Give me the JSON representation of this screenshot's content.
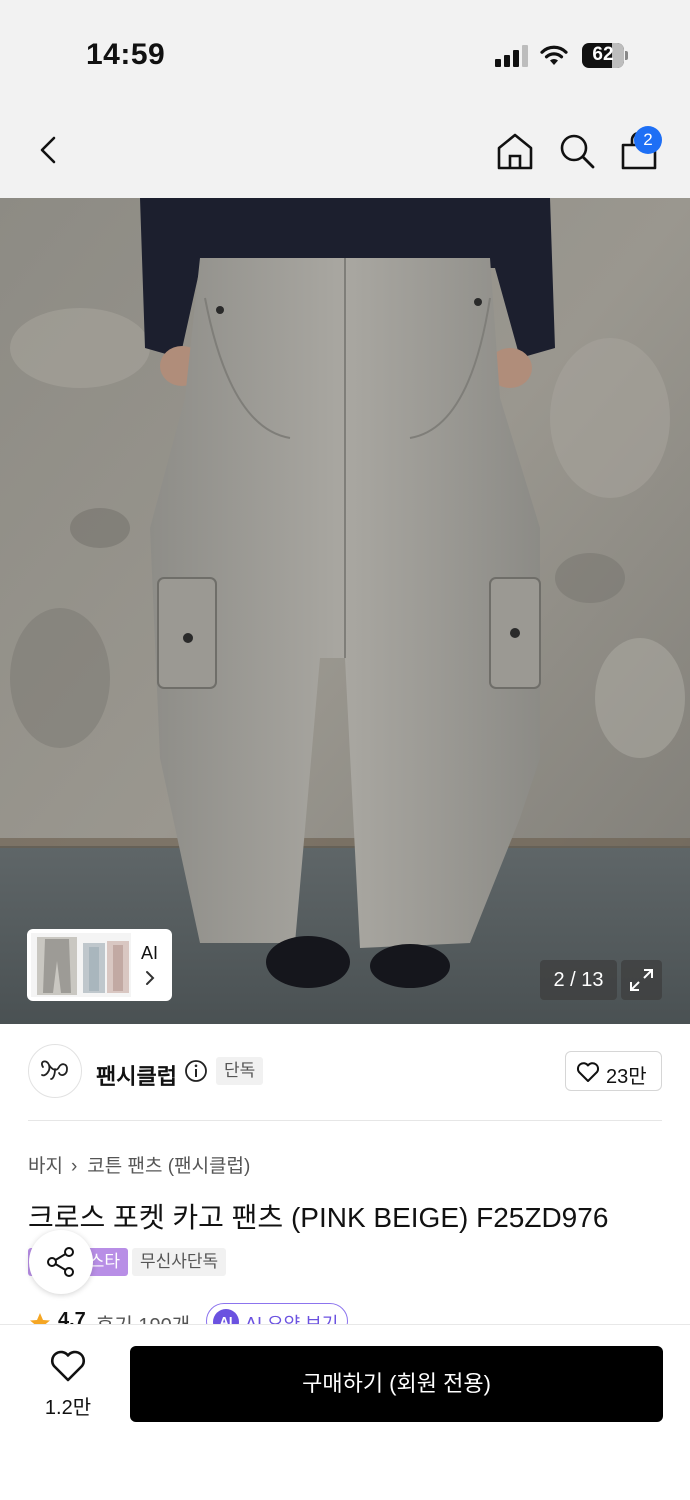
{
  "status_bar": {
    "time": "14:59",
    "battery": "62"
  },
  "nav": {
    "cart_count": "2"
  },
  "gallery": {
    "ai_label": "AI",
    "page_indicator": "2 / 13"
  },
  "brand": {
    "name": "팬시클럽",
    "tag": "단독",
    "like_count": "23만"
  },
  "product": {
    "breadcrumb": [
      "바지",
      "코튼 팬츠 (팬시클럽)"
    ],
    "title": "크로스 포켓 카고 팬츠 (PINK BEIGE) F25ZD976",
    "tags": [
      "스타",
      "무신사단독"
    ],
    "rating": "4.7",
    "review_count": "후기 190개",
    "ai_summary_label": "AI 요약 보기",
    "ai_badge": "AI"
  },
  "bottom_bar": {
    "like_count": "1.2만",
    "buy_label": "구매하기 (회원 전용)"
  },
  "colors": {
    "accent_blue": "#1e6ff5",
    "tag_purple": "#b88ee6",
    "ai_purple": "#6b52e0",
    "star_orange": "#f5a623"
  }
}
